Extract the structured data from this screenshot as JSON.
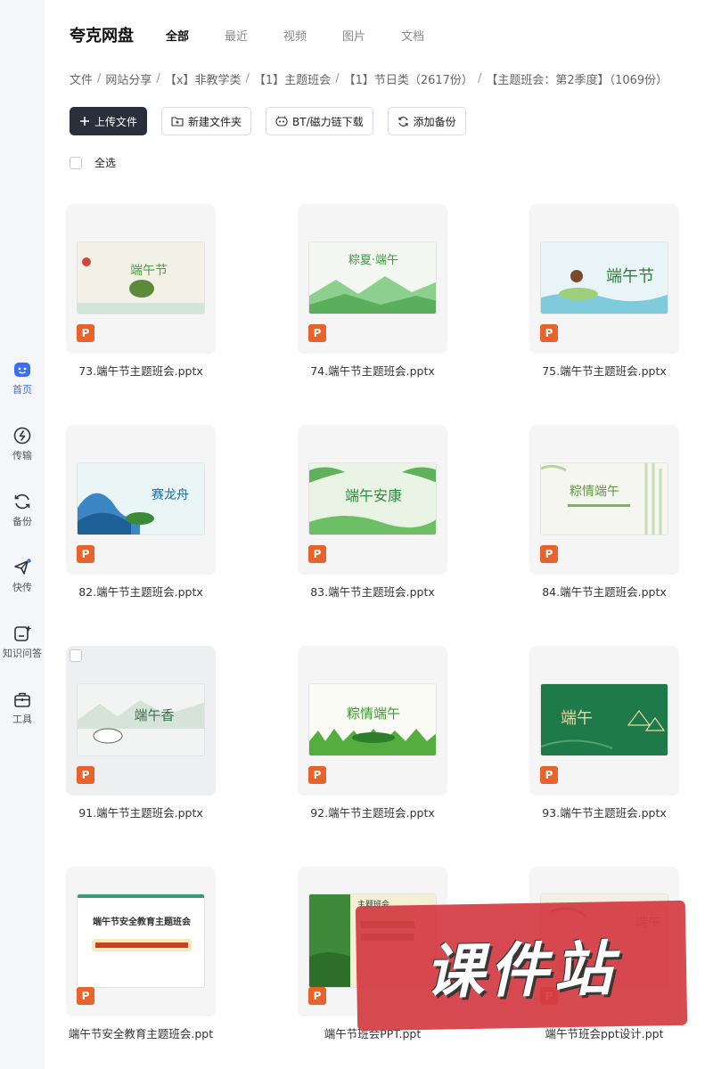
{
  "sidebar": {
    "items": [
      {
        "label": "首页",
        "icon": "home-icon",
        "active": true
      },
      {
        "label": "传输",
        "icon": "transfer-icon",
        "active": false
      },
      {
        "label": "备份",
        "icon": "backup-icon",
        "active": false
      },
      {
        "label": "快传",
        "icon": "quick-transfer-icon",
        "active": false
      },
      {
        "label": "知识问答",
        "icon": "knowledge-qa-icon",
        "active": false
      },
      {
        "label": "工具",
        "icon": "tools-icon",
        "active": false
      }
    ]
  },
  "header": {
    "brand": "夸克网盘",
    "tabs": [
      {
        "label": "全部",
        "active": true
      },
      {
        "label": "最近",
        "active": false
      },
      {
        "label": "视频",
        "active": false
      },
      {
        "label": "图片",
        "active": false
      },
      {
        "label": "文档",
        "active": false
      }
    ]
  },
  "breadcrumb": [
    "文件",
    "网站分享",
    "【x】非教学类",
    "【1】主题班会",
    "【1】节日类（2617份）",
    "【主题班会：第2季度】（1069份）"
  ],
  "toolbar": {
    "upload": "上传文件",
    "new_folder": "新建文件夹",
    "bt_download": "BT/磁力链下载",
    "add_backup": "添加备份"
  },
  "select_all": "全选",
  "file_type_badge": "P",
  "files": [
    {
      "name": "73.端午节主题班会.pptx",
      "thumb_title": "端午节",
      "thumb_bg": "#f3f1e6",
      "thumb_accent": "#4e9a4a"
    },
    {
      "name": "74.端午节主题班会.pptx",
      "thumb_title": "粽夏·端午",
      "thumb_bg": "#f4f6f1",
      "thumb_accent": "#3f9a45"
    },
    {
      "name": "75.端午节主题班会.pptx",
      "thumb_title": "端午节",
      "thumb_bg": "#e8f4f6",
      "thumb_accent": "#2f7d3a"
    },
    {
      "name": "82.端午节主题班会.pptx",
      "thumb_title": "赛龙舟",
      "thumb_bg": "#eaf5f6",
      "thumb_accent": "#1f6aa8"
    },
    {
      "name": "83.端午节主题班会.pptx",
      "thumb_title": "端午安康",
      "thumb_bg": "#e9f4e4",
      "thumb_accent": "#2d8a3b"
    },
    {
      "name": "84.端午节主题班会.pptx",
      "thumb_title": "粽情端午",
      "thumb_bg": "#f4f6ef",
      "thumb_accent": "#5c9a3f"
    },
    {
      "name": "91.端午节主题班会.pptx",
      "thumb_title": "端午香",
      "thumb_bg": "#f1f4f2",
      "thumb_accent": "#3b6e4a"
    },
    {
      "name": "92.端午节主题班会.pptx",
      "thumb_title": "粽情端午",
      "thumb_bg": "#fbfbf6",
      "thumb_accent": "#3a9a2f"
    },
    {
      "name": "93.端午节主题班会.pptx",
      "thumb_title": "端午",
      "thumb_bg": "#1f7a4a",
      "thumb_accent": "#e9d9a4"
    },
    {
      "name": "端午节安全教育主题班会.ppt",
      "thumb_title": "端午节安全教育主题班会",
      "thumb_bg": "#ffffff",
      "thumb_accent": "#c8401e"
    },
    {
      "name": "端午节班会PPT.ppt",
      "thumb_title": "主题班会",
      "thumb_bg": "#f3f0d4",
      "thumb_accent": "#5a8a2a"
    },
    {
      "name": "端午节班会ppt设计.ppt",
      "thumb_title": "端午",
      "thumb_bg": "#f4efe2",
      "thumb_accent": "#9a6a3a"
    }
  ],
  "watermark": "课件站"
}
